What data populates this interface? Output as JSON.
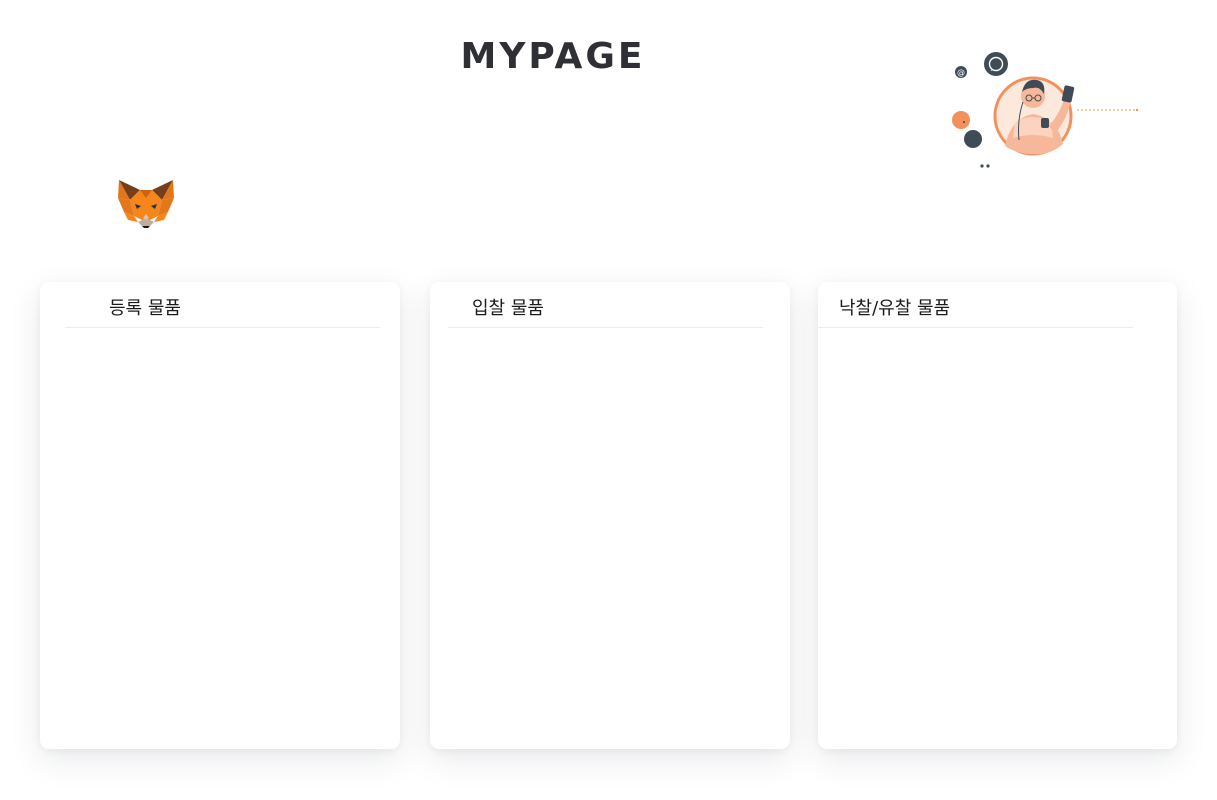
{
  "header": {
    "title": "MYPAGE"
  },
  "wallet": {
    "logo_icon": "metamask-fox-icon"
  },
  "illustration": {
    "icon": "person-phone-illustration",
    "accent_color": "#f4905c",
    "dark_color": "#3f4c57"
  },
  "panels": [
    {
      "title": "등록 물품",
      "items": []
    },
    {
      "title": "입찰 물품",
      "items": []
    },
    {
      "title": "낙찰/유찰 물품",
      "items": []
    }
  ]
}
